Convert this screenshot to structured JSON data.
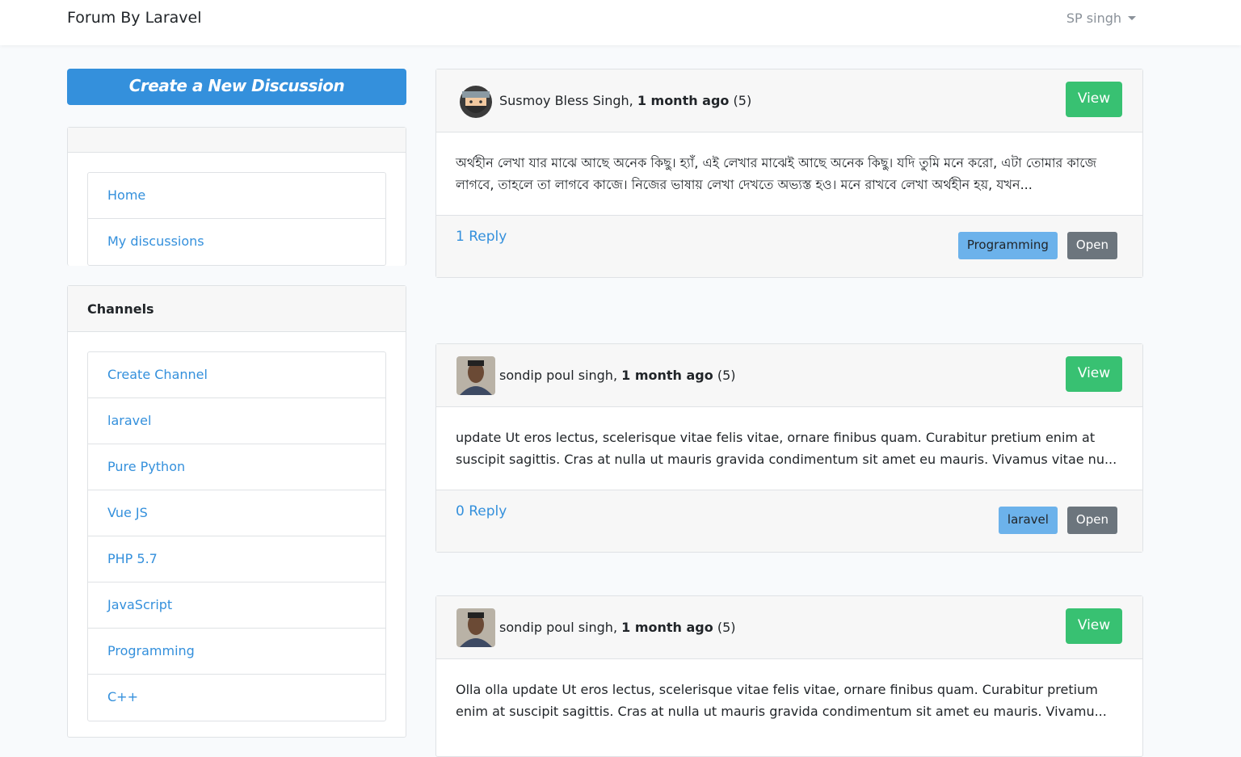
{
  "navbar": {
    "brand": "Forum By Laravel",
    "user": "SP singh"
  },
  "sidebar": {
    "create_button": "Create a New Discussion",
    "nav_items": [
      "Home",
      "My discussions"
    ],
    "channels_title": "Channels",
    "channels": [
      "Create Channel",
      "laravel",
      "Pure Python",
      "Vue JS",
      "PHP 5.7",
      "JavaScript",
      "Programming",
      "C++"
    ]
  },
  "discussions": [
    {
      "author": "Susmoy Bless Singh,",
      "time": "1 month ago",
      "count": "(5)",
      "view": "View",
      "body": "অর্থহীন লেখা যার মাঝে আছে অনেক কিছু। হ্যাঁ, এই লেখার মাঝেই আছে অনেক কিছু। যদি তুমি মনে করো, এটা তোমার কাজে লাগবে, তাহলে তা লাগবে কাজে। নিজের ভাষায় লেখা দেখতে অভ্যস্ত হও। মনে রাখবে লেখা অর্থহীন হয়, যখন...",
      "replies": "1 Reply",
      "channel": "Programming",
      "status": "Open",
      "avatar": "ninja"
    },
    {
      "author": "sondip poul singh,",
      "time": "1 month ago",
      "count": "(5)",
      "view": "View",
      "body": "update Ut eros lectus, scelerisque vitae felis vitae, ornare finibus quam. Curabitur pretium enim at suscipit sagittis. Cras at nulla ut mauris gravida condimentum sit amet eu mauris. Vivamus vitae nu...",
      "replies": "0 Reply",
      "channel": "laravel",
      "status": "Open",
      "avatar": "photo"
    },
    {
      "author": "sondip poul singh,",
      "time": "1 month ago",
      "count": "(5)",
      "view": "View",
      "body": "Olla olla update Ut eros lectus, scelerisque vitae felis vitae, ornare finibus quam. Curabitur pretium enim at suscipit sagittis. Cras at nulla ut mauris gravida condimentum sit amet eu mauris. Vivamu...",
      "avatar": "photo"
    }
  ]
}
